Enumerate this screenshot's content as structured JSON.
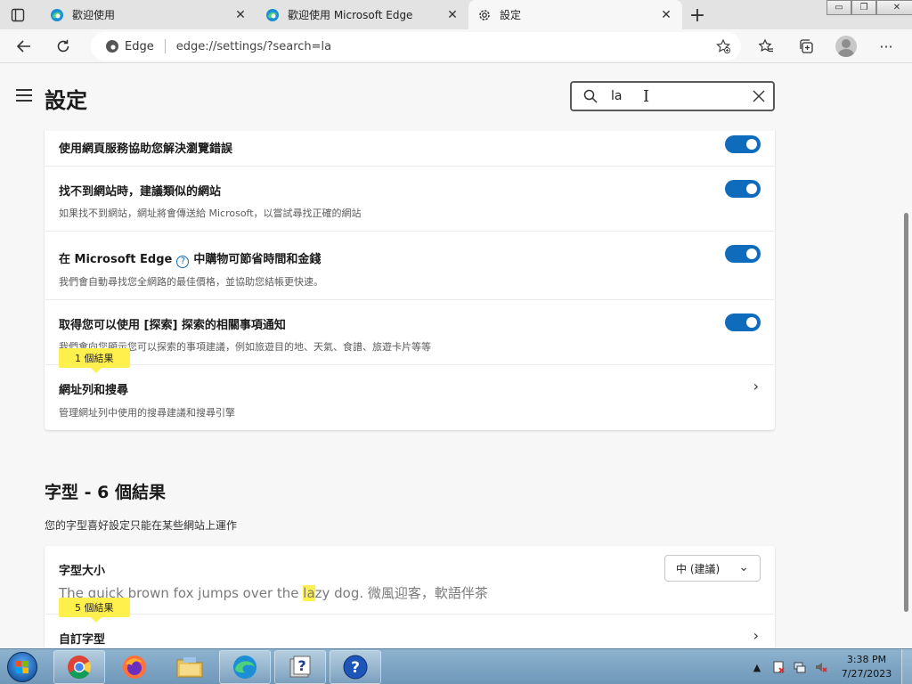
{
  "tabs": [
    {
      "title": "歡迎使用",
      "close": "✕"
    },
    {
      "title": "歡迎使用 Microsoft Edge",
      "close": "✕"
    },
    {
      "title": "設定",
      "close": "✕"
    }
  ],
  "window_controls": {
    "minimize": "▭",
    "restore": "❐",
    "close": "✕"
  },
  "address_bar": {
    "site_label": "Edge",
    "url": "edge://settings/?search=la"
  },
  "settings": {
    "title": "設定",
    "search_value": "la"
  },
  "privacy_rows": [
    {
      "title": "使用網頁服務協助您解決瀏覽錯誤",
      "desc": "",
      "toggle": true
    },
    {
      "title": "找不到網站時，建議類似的網站",
      "desc": "如果找不到網站，網址將會傳送給 Microsoft，以嘗試尋找正確的網站",
      "toggle": true
    },
    {
      "title_pre": "在 Microsoft Edge",
      "title_post": "中購物可節省時間和金錢",
      "desc": "我們會自動尋找您全網路的最佳價格，並協助您結帳更快速。",
      "toggle": true
    },
    {
      "title": "取得您可以使用 [探索] 探索的相關事項通知",
      "desc": "我們會向您顯示您可以探索的事項建議，例如旅遊目的地、天氣、食譜、旅遊卡片等等",
      "toggle": true
    },
    {
      "title": "網址列和搜尋",
      "desc": "管理網址列中使用的搜尋建議和搜尋引擎",
      "link": true,
      "badge": "1 個結果"
    }
  ],
  "fonts_section": {
    "title": "字型 - 6 個結果",
    "desc": "您的字型喜好設定只能在某些網站上運作",
    "font_size_label": "字型大小",
    "font_size_value": "中 (建議)",
    "preview_pre": "The quick brown fox jumps over the ",
    "preview_hl": "la",
    "preview_post": "zy dog. 微風迎客，軟語伴茶",
    "custom_fonts_label": "自訂字型",
    "custom_badge": "5 個結果"
  },
  "taskbar": {
    "apps": [
      "chrome",
      "firefox",
      "file-explorer",
      "edge",
      "help-file",
      "help"
    ],
    "clock_time": "3:38 PM",
    "clock_date": "7/27/2023"
  },
  "colors": {
    "toggle_on": "#0f6cbd",
    "highlight": "#fff04d"
  }
}
